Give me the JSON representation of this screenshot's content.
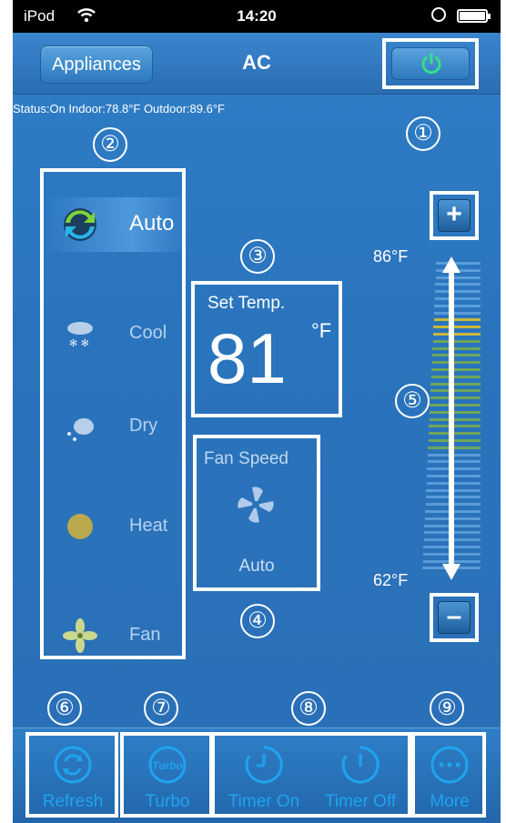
{
  "statusbar": {
    "carrier": "iPod",
    "time": "14:20"
  },
  "navbar": {
    "back_label": "Appliances",
    "title": "AC"
  },
  "status_line": "Status:On  Indoor:78.8°F  Outdoor:89.6°F",
  "modes": [
    {
      "label": "Auto",
      "icon": "auto-mode-icon",
      "selected": true
    },
    {
      "label": "Cool",
      "icon": "cool-mode-icon",
      "selected": false
    },
    {
      "label": "Dry",
      "icon": "dry-mode-icon",
      "selected": false
    },
    {
      "label": "Heat",
      "icon": "heat-mode-icon",
      "selected": false
    },
    {
      "label": "Fan",
      "icon": "fan-mode-icon",
      "selected": false
    }
  ],
  "set_temp": {
    "label": "Set Temp.",
    "value": "81",
    "unit": "°F"
  },
  "fan_speed": {
    "label": "Fan Speed",
    "value": "Auto"
  },
  "slider": {
    "max_label": "86°F",
    "min_label": "62°F",
    "plus": "+",
    "minus": "–"
  },
  "callouts": [
    "①",
    "②",
    "③",
    "④",
    "⑤",
    "⑥",
    "⑦",
    "⑧",
    "⑨"
  ],
  "toolbar": {
    "refresh": "Refresh",
    "turbo": "Turbo",
    "turbo_icon_text": "Turbo",
    "timer_on": "Timer On",
    "timer_off": "Timer Off",
    "more": "More"
  },
  "colors": {
    "background": "#2a74bd",
    "accent": "#1ea4ef",
    "power_green": "#33e08a"
  }
}
